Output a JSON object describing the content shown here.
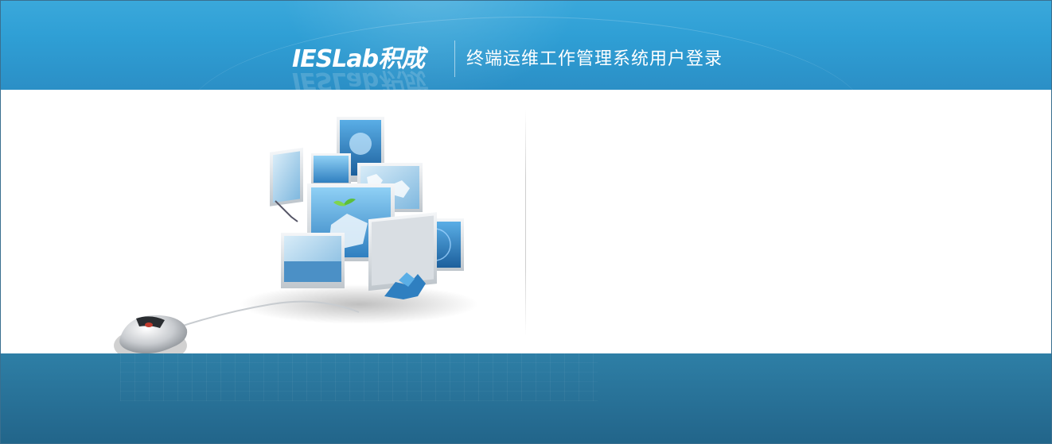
{
  "header": {
    "logo_text": "IESLab积成",
    "system_title": "终端运维工作管理系统用户登录"
  },
  "colors": {
    "header_blue": "#2f9fd5",
    "footer_blue": "#276f95",
    "panel_bg": "#ffffff"
  },
  "icons": {
    "illustration": "monitors-and-mouse-illustration"
  }
}
